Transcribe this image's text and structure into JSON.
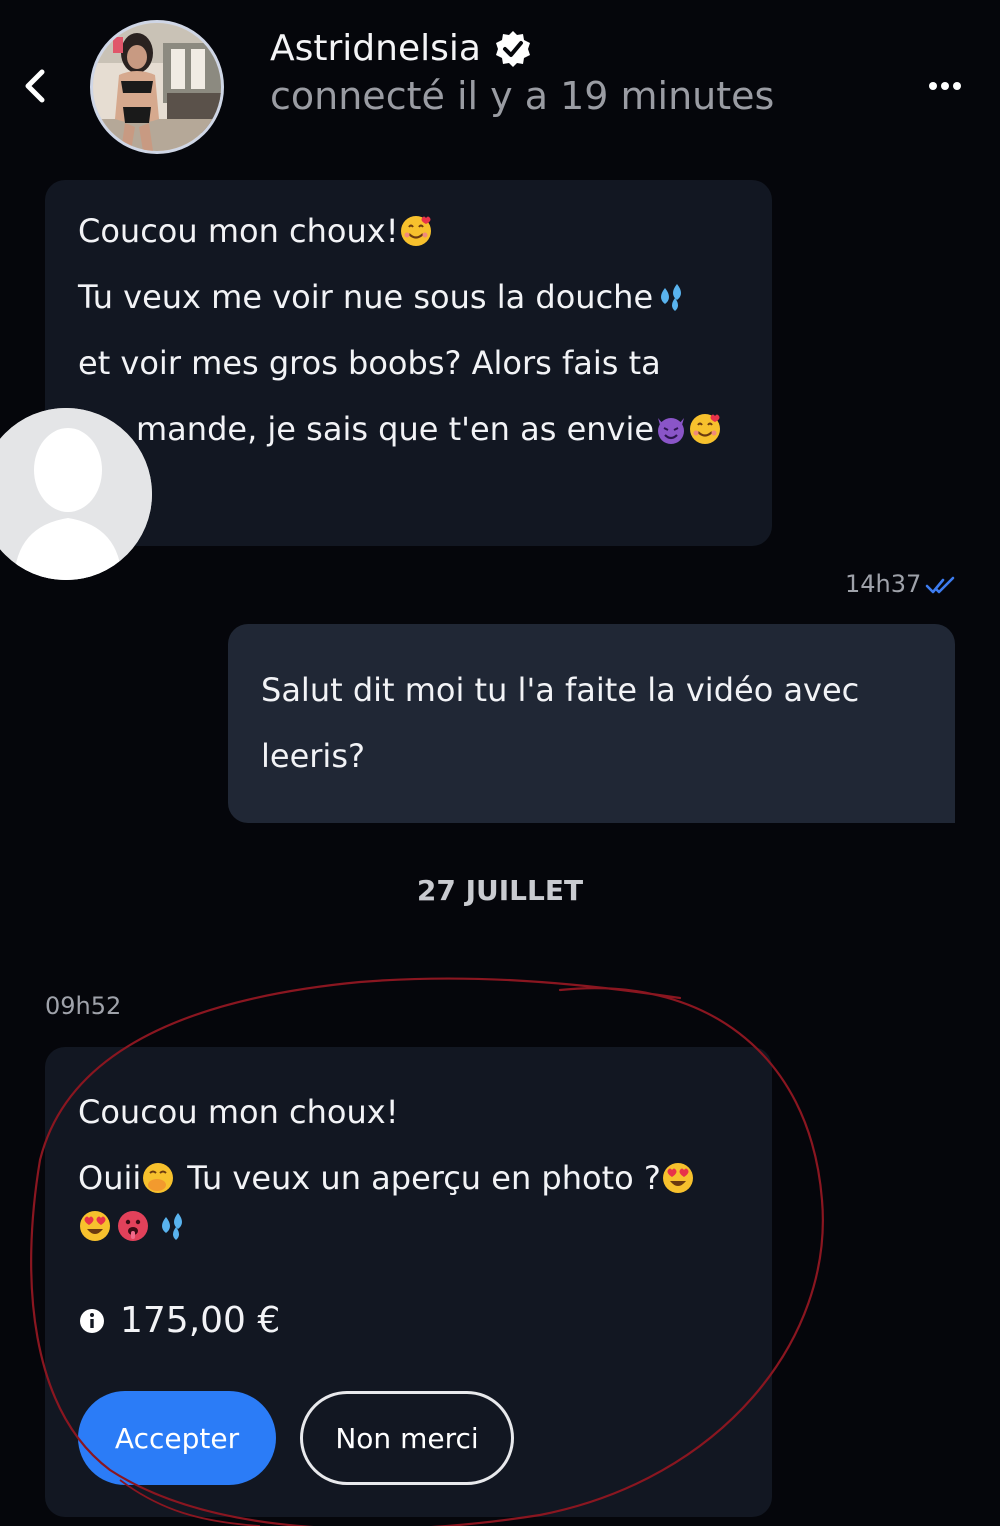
{
  "header": {
    "name": "Astridnelsia",
    "status": "connecté il y a 19 minutes",
    "back_icon": "chevron-left-icon",
    "verified_icon": "verified-badge-icon",
    "more_icon": "more-horizontal-icon"
  },
  "messages": [
    {
      "direction": "incoming",
      "lines": [
        "Coucou mon choux!",
        "Tu veux me voir nue sous la douche",
        "et voir mes gros boobs? Alors fais ta",
        "mande, je sais que t'en as envie"
      ],
      "emojis": [
        "smiling-face-with-hearts",
        "sweat-droplets",
        "smiling-face-with-horns",
        "smiling-face-with-hearts"
      ]
    },
    {
      "direction": "outgoing",
      "time": "14h37",
      "read_icon": "double-check-icon",
      "lines": [
        "Salut dit moi tu l'a faite la vidéo avec",
        "leeris?"
      ]
    },
    {
      "direction": "incoming",
      "time": "09h52",
      "lines": [
        "Coucou mon choux!",
        "Ouii",
        "Tu veux un aperçu en photo ?"
      ],
      "emojis": [
        "face-with-hand-over-mouth",
        "smiling-face-with-heart-eyes",
        "smiling-face-with-heart-eyes",
        "hot-face",
        "sweat-droplets"
      ],
      "price": "175,00 €",
      "price_icon": "info-icon",
      "accept_label": "Accepter",
      "decline_label": "Non merci"
    }
  ],
  "date_separator": "27 JUILLET",
  "colors": {
    "background": "#05060b",
    "bubble_incoming": "#121722",
    "bubble_outgoing": "#202735",
    "accent": "#2b7cf7",
    "read_check": "#3d7cf0",
    "annotation": "#8a1620"
  }
}
